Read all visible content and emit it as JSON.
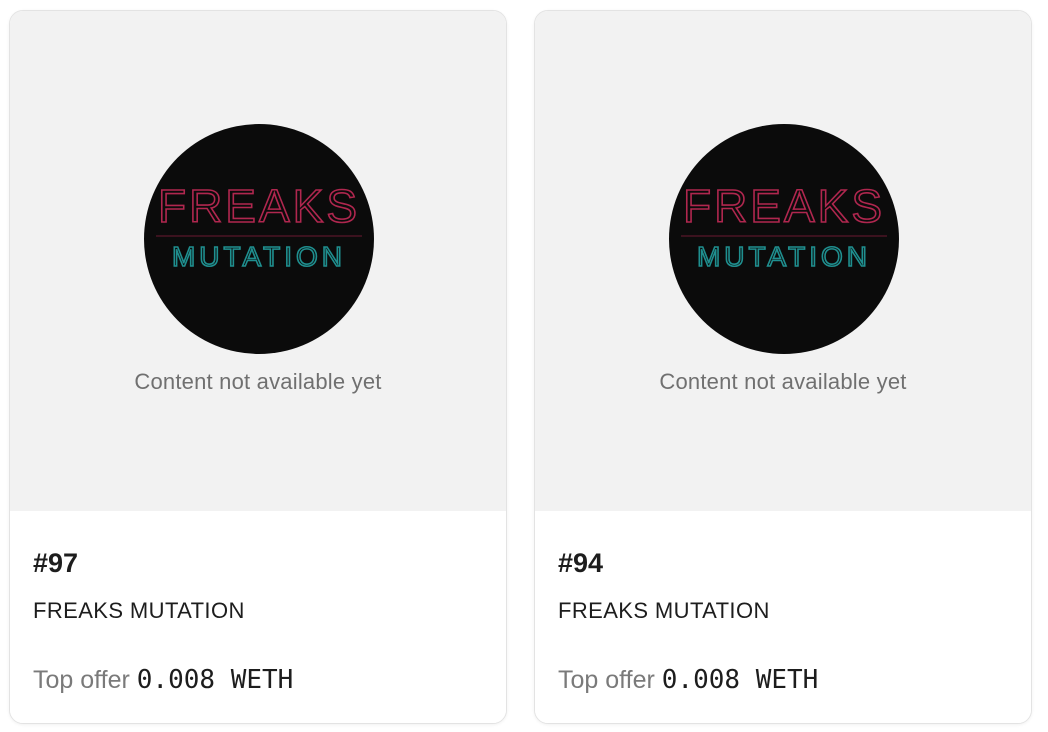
{
  "colors": {
    "media_background": "#f2f2f2",
    "logo_background": "#0b0b0b",
    "neon_pink": "#b0274f",
    "neon_teal": "#1f8f8f"
  },
  "cards": [
    {
      "logo_word_top": "FREAKS",
      "logo_word_bottom": "MUTATION",
      "unavailable_text": "Content not available yet",
      "token_id": "#97",
      "collection": "FREAKS MUTATION",
      "offer_label": "Top offer",
      "offer_value": "0.008 WETH"
    },
    {
      "logo_word_top": "FREAKS",
      "logo_word_bottom": "MUTATION",
      "unavailable_text": "Content not available yet",
      "token_id": "#94",
      "collection": "FREAKS MUTATION",
      "offer_label": "Top offer",
      "offer_value": "0.008 WETH"
    }
  ]
}
